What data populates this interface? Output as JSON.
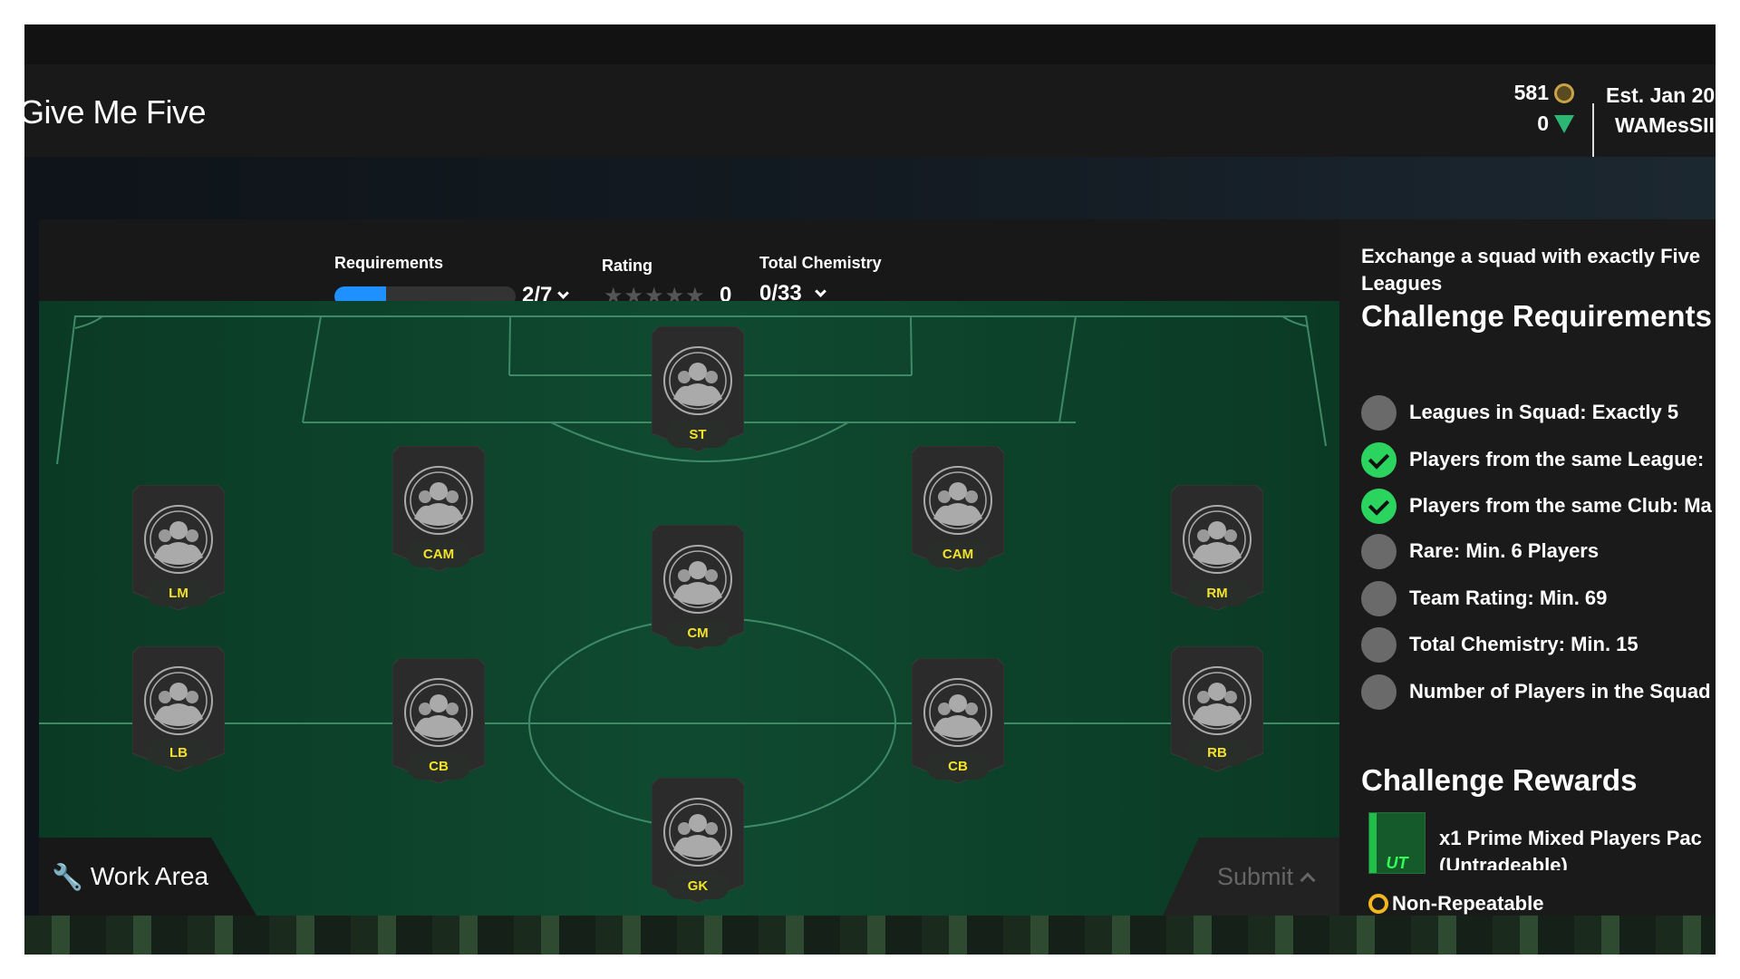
{
  "header": {
    "title": "Give Me Five",
    "coins": "581",
    "points": "0",
    "coin_icon": "coin-icon",
    "points_icon": "fc-points-icon",
    "est": "Est. Jan 20",
    "username": "WAMesSII"
  },
  "stats": {
    "requirements_label": "Requirements",
    "requirements_value": "2/7",
    "requirements_progress": 0.286,
    "rating_label": "Rating",
    "rating_stars": 0,
    "rating_value": "0",
    "chemistry_label": "Total Chemistry",
    "chemistry_value": "0/33"
  },
  "positions": [
    {
      "label": "ST"
    },
    {
      "label": "CAM"
    },
    {
      "label": "CAM"
    },
    {
      "label": "LM"
    },
    {
      "label": "CM"
    },
    {
      "label": "RM"
    },
    {
      "label": "LB"
    },
    {
      "label": "CB"
    },
    {
      "label": "CB"
    },
    {
      "label": "RB"
    },
    {
      "label": "GK"
    }
  ],
  "work_area_label": "Work Area",
  "submit_label": "Submit",
  "panel": {
    "description": "Exchange a squad with exactly Five Leagues",
    "requirements_title": "Challenge Requirements",
    "requirements": [
      {
        "text": "Leagues in Squad: Exactly 5",
        "met": false
      },
      {
        "text": "Players from the same League:",
        "met": true
      },
      {
        "text": "Players from the same Club: Ma",
        "met": true
      },
      {
        "text": "Rare: Min. 6 Players",
        "met": false
      },
      {
        "text": "Team Rating: Min. 69",
        "met": false
      },
      {
        "text": "Total Chemistry: Min. 15",
        "met": false
      },
      {
        "text": "Number of Players in the Squad",
        "met": false
      }
    ],
    "rewards_title": "Challenge Rewards",
    "reward_pack_logo": "UT",
    "reward_line1": "x1 Prime Mixed Players Pac",
    "reward_line2": "(Untradeable)",
    "non_repeatable": "Non-Repeatable"
  },
  "colors": {
    "accent_blue": "#1e90ff",
    "check_green": "#2bd45f",
    "position_yellow": "#f2e22a",
    "pitch_green": "#0f4a30"
  }
}
